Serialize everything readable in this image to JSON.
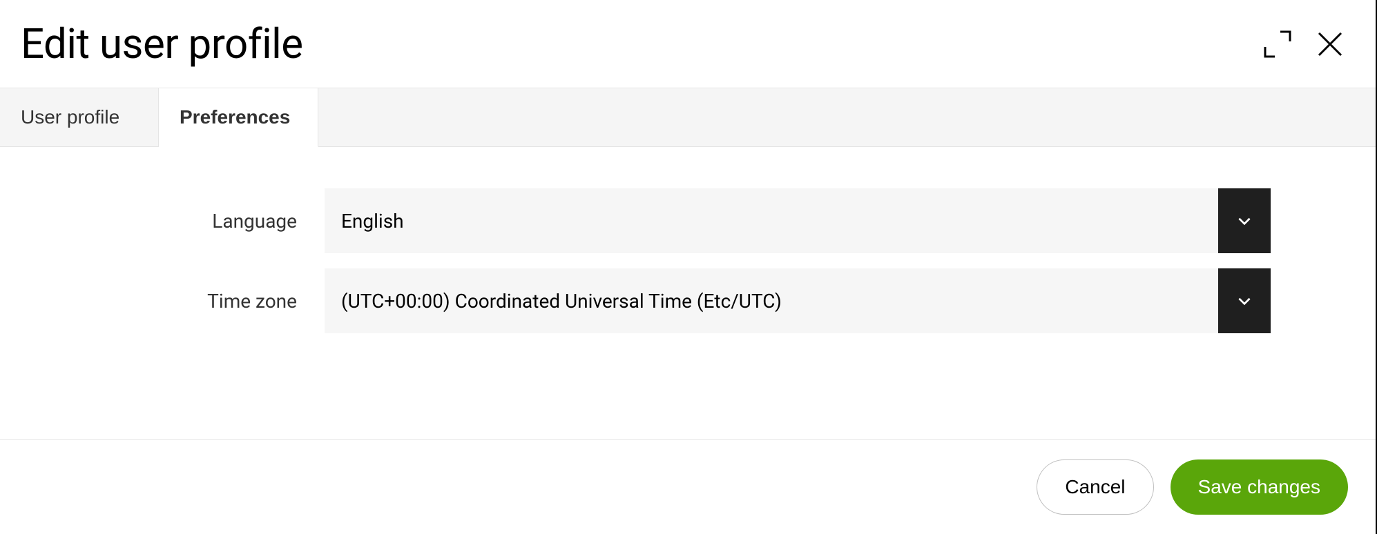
{
  "header": {
    "title": "Edit user profile"
  },
  "tabs": {
    "user_profile": "User profile",
    "preferences": "Preferences"
  },
  "form": {
    "language": {
      "label": "Language",
      "value": "English"
    },
    "timezone": {
      "label": "Time zone",
      "value": "(UTC+00:00) Coordinated Universal Time (Etc/UTC)"
    }
  },
  "footer": {
    "cancel": "Cancel",
    "save": "Save changes"
  }
}
